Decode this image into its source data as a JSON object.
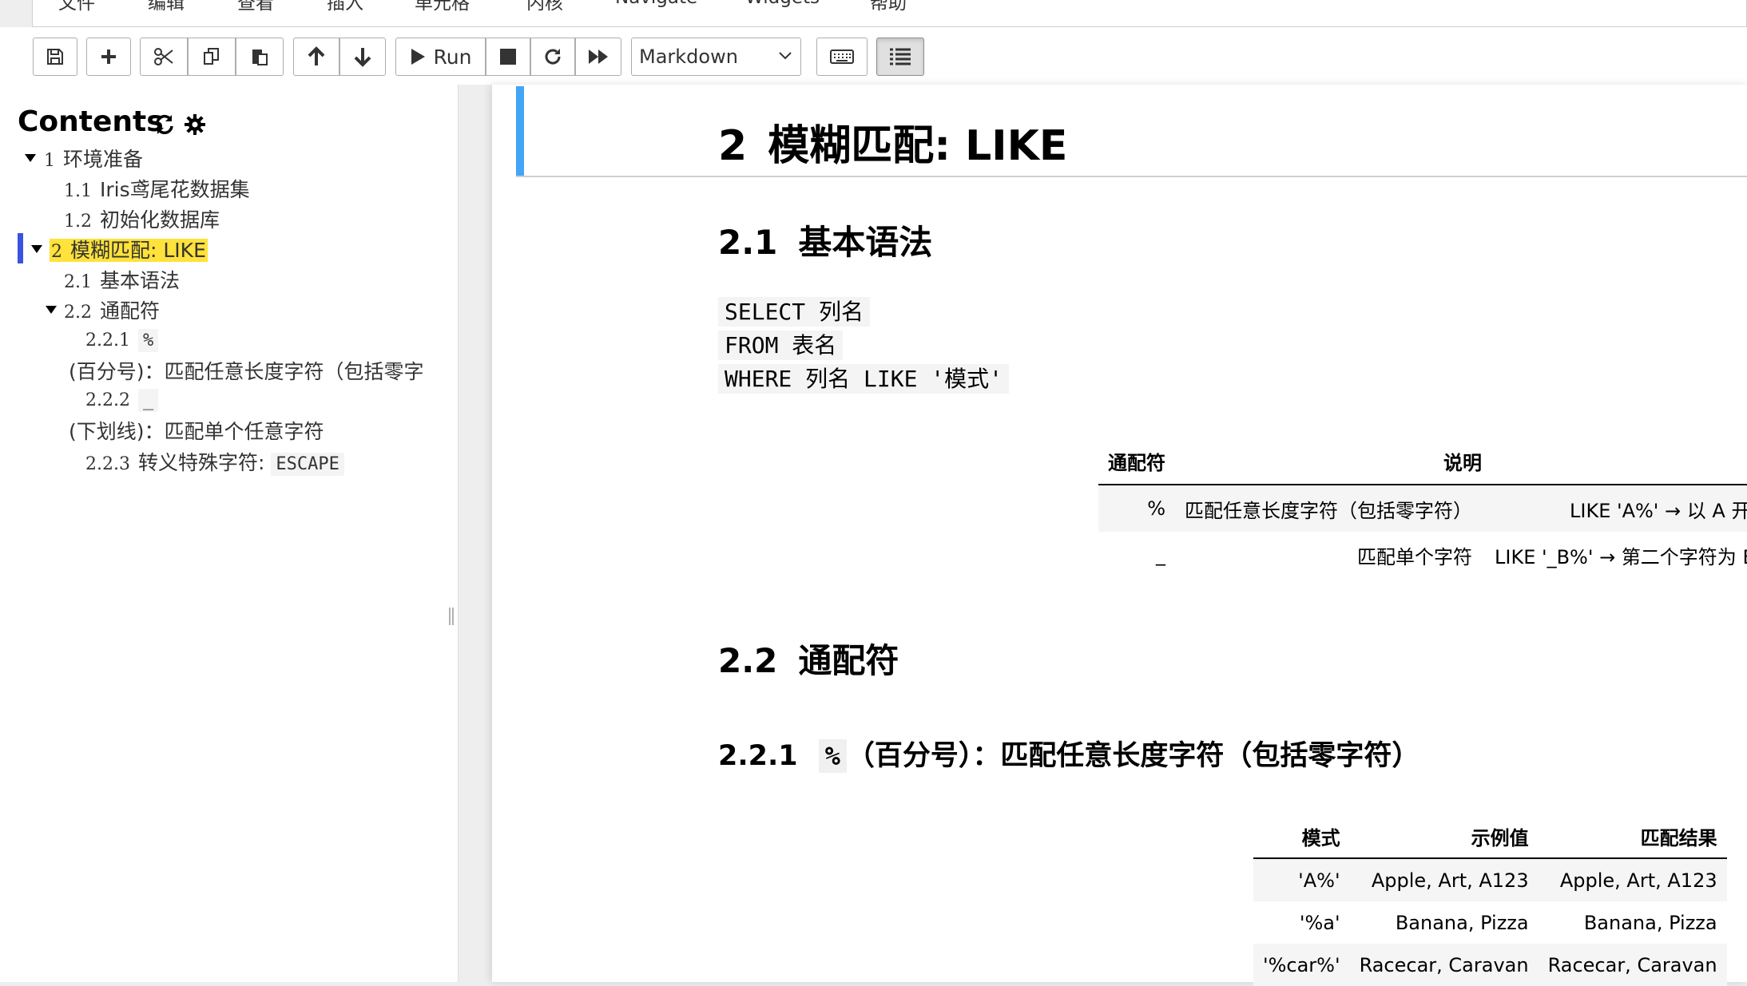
{
  "menubar": {
    "items": [
      "文件",
      "编辑",
      "查看",
      "插入",
      "单元格",
      "内核",
      "Navigate",
      "Widgets",
      "帮助"
    ]
  },
  "toolbar": {
    "buttons": [
      "save-icon",
      "plus-icon",
      "scissors-icon",
      "copy-icon",
      "paste-icon",
      "arrow-up-icon",
      "arrow-down-icon",
      "play-icon",
      "stop-icon",
      "restart-icon",
      "fast-forward-icon",
      "keyboard-icon",
      "list-icon"
    ],
    "run_label": "Run",
    "cell_type": "Markdown"
  },
  "toc": {
    "title": "Contents",
    "items": [
      {
        "num": "1",
        "label": "环境准备"
      },
      {
        "num": "1.1",
        "label": "Iris鸢尾花数据集"
      },
      {
        "num": "1.2",
        "label": "初始化数据库"
      },
      {
        "num": "2",
        "label": "模糊匹配: LIKE"
      },
      {
        "num": "2.1",
        "label": "基本语法"
      },
      {
        "num": "2.2",
        "label": "通配符"
      },
      {
        "num": "2.2.1",
        "code": "%",
        "label": "(百分号)：匹配任意长度字符（包括零字"
      },
      {
        "num": "2.2.2",
        "code": "_",
        "label": "(下划线)：匹配单个任意字符"
      },
      {
        "num": "2.2.3",
        "label": "转义特殊字符: ",
        "code": "ESCAPE"
      }
    ]
  },
  "notebook": {
    "h2": {
      "num": "2",
      "text": "模糊匹配: LIKE"
    },
    "h21": {
      "num": "2.1",
      "text": "基本语法"
    },
    "code": [
      "SELECT 列名",
      "FROM 表名",
      "WHERE 列名 LIKE '模式'"
    ],
    "table1": {
      "headers": [
        "通配符",
        "说明",
        ""
      ],
      "rows": [
        [
          "%",
          "匹配任意长度字符（包括零字符）",
          "LIKE 'A%' → 以 A 开头"
        ],
        [
          "_",
          "匹配单个字符",
          "LIKE '_B%' → 第二个字符为 B"
        ]
      ]
    },
    "h22": {
      "num": "2.2",
      "text": "通配符"
    },
    "h221": {
      "num": "2.2.1",
      "code": "%",
      "text": "（百分号）：匹配任意长度字符（包括零字符）"
    },
    "table2": {
      "headers": [
        "模式",
        "示例值",
        "匹配结果"
      ],
      "rows": [
        [
          "'A%'",
          "Apple, Art, A123",
          "Apple, Art, A123"
        ],
        [
          "'%a'",
          "Banana, Pizza",
          "Banana, Pizza"
        ],
        [
          "'%car%'",
          "Racecar, Caravan",
          "Racecar, Caravan"
        ]
      ]
    }
  }
}
